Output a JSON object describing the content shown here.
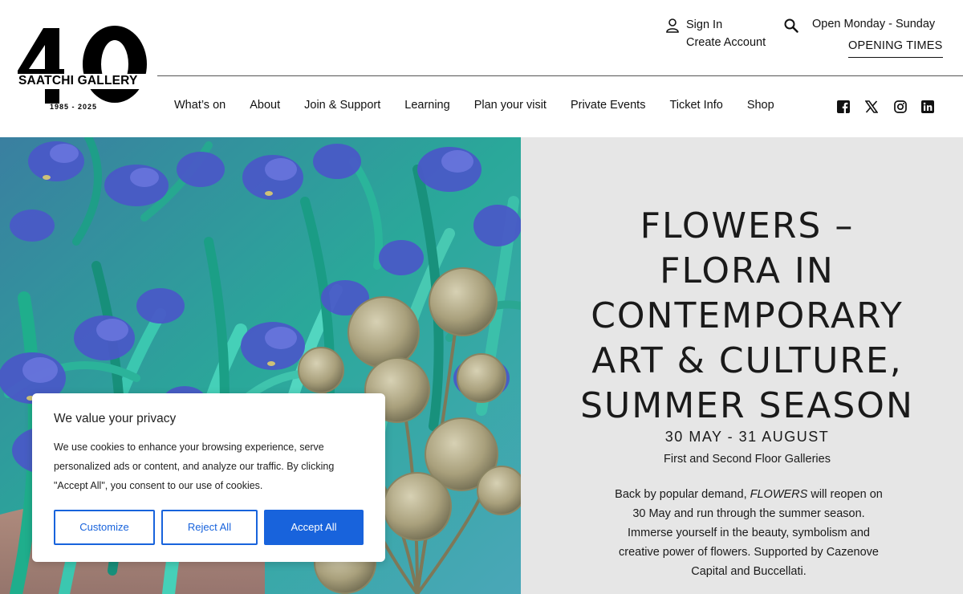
{
  "logo": {
    "big_mark": "40",
    "name": "SAATCHI GALLERY",
    "years": "1985 - 2025"
  },
  "account": {
    "sign_in": "Sign In",
    "create_account": "Create Account"
  },
  "hours": {
    "days": "Open Monday - Sunday",
    "link": "OPENING TIMES"
  },
  "nav": {
    "items": [
      "What’s on",
      "About",
      "Join & Support",
      "Learning",
      "Plan your visit",
      "Private Events",
      "Ticket Info",
      "Shop"
    ]
  },
  "social": [
    "facebook-icon",
    "x-twitter-icon",
    "instagram-icon",
    "linkedin-icon"
  ],
  "hero": {
    "title_lines": [
      "FLOWERS –",
      "FLORA IN",
      "CONTEMPORARY",
      "ART & CULTURE,",
      "SUMMER SEASON"
    ],
    "dates": "30 MAY - 31 AUGUST",
    "location": "First and Second Floor Galleries",
    "desc_before": "Back by popular demand, ",
    "desc_em": "FLOWERS",
    "desc_after": " will reopen on 30 May and run through the summer season. Immerse yourself in the beauty, symbolism and creative power of flowers. Supported by Cazenove Capital and Buccellati."
  },
  "cookie": {
    "title": "We value your privacy",
    "text": "We use cookies to enhance your browsing experience, serve personalized ads or content, and analyze our traffic. By clicking \"Accept All\", you consent to our use of cookies.",
    "customize": "Customize",
    "reject": "Reject All",
    "accept": "Accept All"
  },
  "colors": {
    "accent_blue": "#1863dc",
    "panel_gray": "#e6e6e6",
    "text_dark": "#1a1a1a"
  }
}
